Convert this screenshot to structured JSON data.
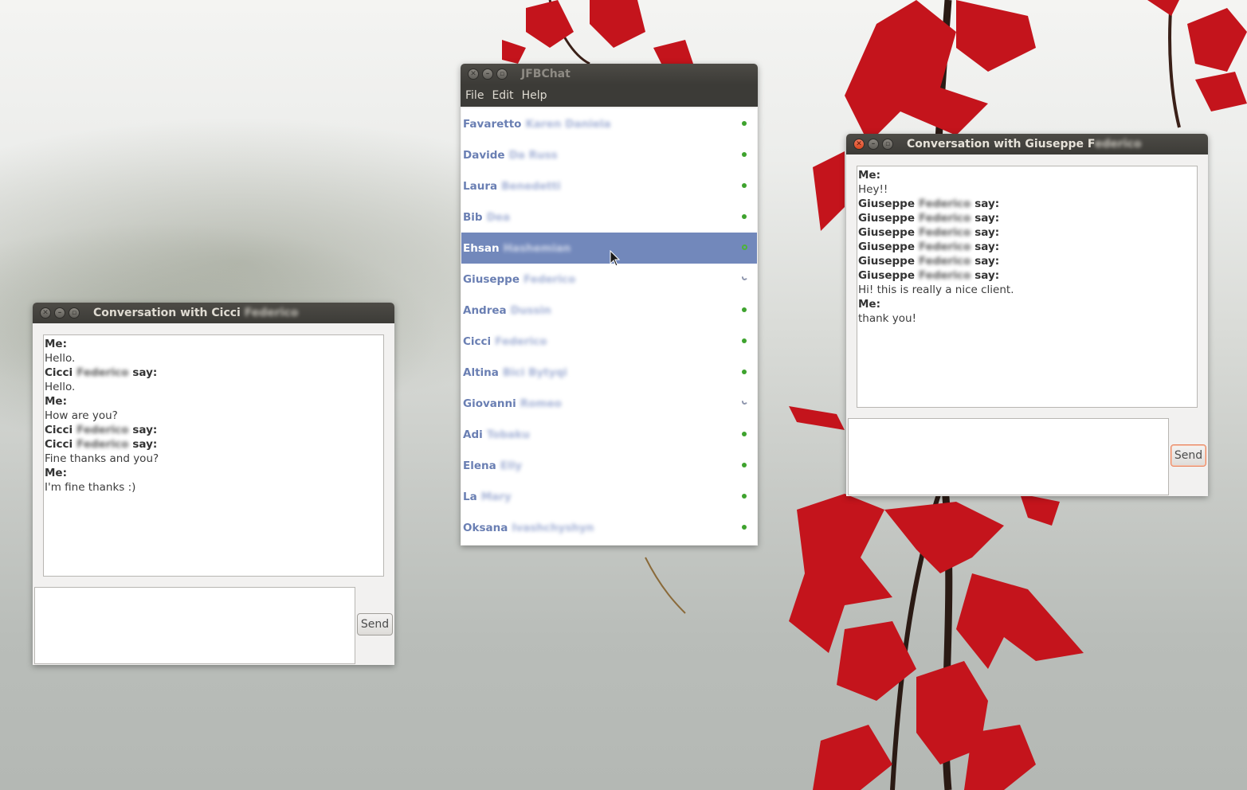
{
  "colors": {
    "titlebar": "#3c3b37",
    "selection": "#7288bb",
    "contact_text": "#6a7fb3",
    "online": "#3ea32e",
    "close_active": "#e35b2f"
  },
  "main_window": {
    "title": "JFBChat",
    "menu": [
      "File",
      "Edit",
      "Help"
    ],
    "contacts": [
      {
        "first": "Favaretto",
        "last": "Karen Daniela",
        "status": "online"
      },
      {
        "first": "Davide",
        "last": "Da Russ",
        "status": "online"
      },
      {
        "first": "Laura",
        "last": "Benedetti",
        "status": "online"
      },
      {
        "first": "Bib",
        "last": "Dea",
        "status": "online"
      },
      {
        "first": "Ehsan",
        "last": "Hashemian",
        "status": "online",
        "selected": true
      },
      {
        "first": "Giuseppe",
        "last": "Federico",
        "status": "away"
      },
      {
        "first": "Andrea",
        "last": "Dussin",
        "status": "online"
      },
      {
        "first": "Cicci",
        "last": "Federico",
        "status": "online"
      },
      {
        "first": "Altina",
        "last": "Bici Bytyqi",
        "status": "online"
      },
      {
        "first": "Giovanni",
        "last": "Romeo",
        "status": "away"
      },
      {
        "first": "Adi",
        "last": "Tobaku",
        "status": "online"
      },
      {
        "first": "Elena",
        "last": "Elly",
        "status": "online"
      },
      {
        "first": "La",
        "last": "Mary",
        "status": "online"
      },
      {
        "first": "Oksana",
        "last": "Ivashchyshyn",
        "status": "online"
      }
    ]
  },
  "conv_left": {
    "title_prefix": "Conversation with Cicci",
    "title_hidden": "Federico",
    "messages": [
      {
        "type": "sender",
        "name": "Me:"
      },
      {
        "type": "text",
        "text": "Hello."
      },
      {
        "type": "sender",
        "first": "Cicci",
        "hidden": "Federico",
        "suffix": "say:"
      },
      {
        "type": "text",
        "text": "Hello."
      },
      {
        "type": "sender",
        "name": "Me:"
      },
      {
        "type": "text",
        "text": "How are you?"
      },
      {
        "type": "sender",
        "first": "Cicci",
        "hidden": "Federico",
        "suffix": "say:"
      },
      {
        "type": "sender",
        "first": "Cicci",
        "hidden": "Federico",
        "suffix": "say:"
      },
      {
        "type": "text",
        "text": "Fine thanks and you?"
      },
      {
        "type": "sender",
        "name": "Me:"
      },
      {
        "type": "text",
        "text": "I'm fine thanks :)"
      }
    ],
    "input_value": "",
    "send_label": "Send"
  },
  "conv_right": {
    "title_prefix": "Conversation with Giuseppe F",
    "title_hidden": "ederico",
    "messages": [
      {
        "type": "sender",
        "name": "Me:"
      },
      {
        "type": "text",
        "text": "Hey!!"
      },
      {
        "type": "sender",
        "first": "Giuseppe",
        "hidden": "Federico",
        "suffix": "say:"
      },
      {
        "type": "sender",
        "first": "Giuseppe",
        "hidden": "Federico",
        "suffix": "say:"
      },
      {
        "type": "sender",
        "first": "Giuseppe",
        "hidden": "Federico",
        "suffix": "say:"
      },
      {
        "type": "sender",
        "first": "Giuseppe",
        "hidden": "Federico",
        "suffix": "say:"
      },
      {
        "type": "sender",
        "first": "Giuseppe",
        "hidden": "Federico",
        "suffix": "say:"
      },
      {
        "type": "sender",
        "first": "Giuseppe",
        "hidden": "Federico",
        "suffix": "say:"
      },
      {
        "type": "text",
        "text": "Hi! this is really a nice client."
      },
      {
        "type": "sender",
        "name": "Me:"
      },
      {
        "type": "text",
        "text": "thank you!"
      }
    ],
    "input_value": "",
    "send_label": "Send"
  },
  "icons": {
    "close": "close-icon",
    "minimize": "minimize-icon",
    "maximize": "maximize-icon",
    "status_online": "online-status-icon",
    "status_away": "away-status-icon",
    "cursor": "mouse-pointer-icon"
  }
}
